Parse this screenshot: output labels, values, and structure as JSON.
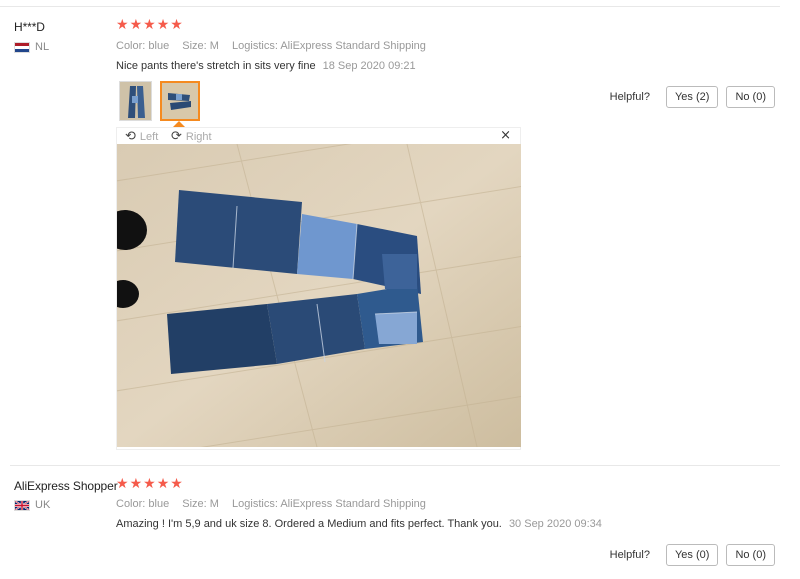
{
  "reviews": [
    {
      "user": "H***D",
      "country": "NL",
      "stars": [
        "★",
        "★",
        "★",
        "★",
        "★"
      ],
      "color_label": "Color:",
      "color": "blue",
      "size_label": "Size:",
      "size": "M",
      "logistics_label": "Logistics:",
      "logistics": "AliExpress Standard Shipping",
      "text": "Nice pants there's stretch in sits very fine",
      "date": "18 Sep 2020 09:21",
      "helpful_label": "Helpful?",
      "yes": "Yes (2)",
      "no": "No (0)",
      "viewer": {
        "left": "Left",
        "right": "Right",
        "close": "×"
      }
    },
    {
      "user": "AliExpress Shopper",
      "country": "UK",
      "stars": [
        "★",
        "★",
        "★",
        "★",
        "★"
      ],
      "color_label": "Color:",
      "color": "blue",
      "size_label": "Size:",
      "size": "M",
      "logistics_label": "Logistics:",
      "logistics": "AliExpress Standard Shipping",
      "text": "Amazing ! I'm 5,9 and uk size 8. Ordered a Medium and fits perfect. Thank you.",
      "date": "30 Sep 2020 09:34",
      "helpful_label": "Helpful?",
      "yes": "Yes (0)",
      "no": "No (0)"
    }
  ],
  "colors": {
    "star": "#f55b4b",
    "accent_border": "#f58a1f"
  },
  "icons": {
    "rotate_left": "rotate-left-icon",
    "rotate_right": "rotate-right-icon",
    "close": "close-icon"
  }
}
